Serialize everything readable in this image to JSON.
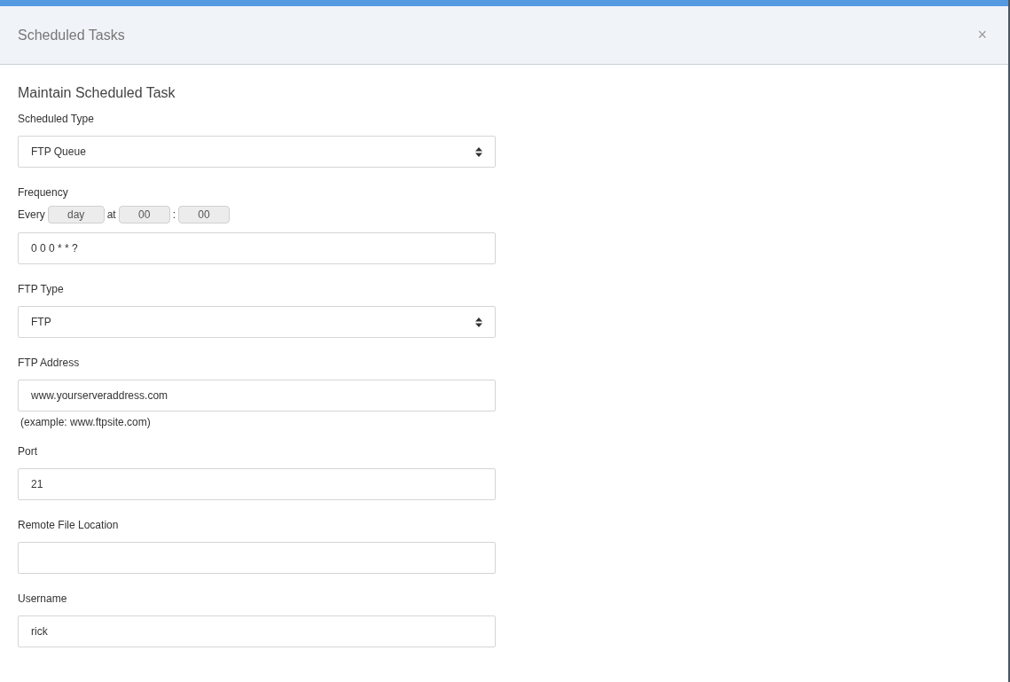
{
  "window": {
    "title": "Scheduled Tasks",
    "close": "×"
  },
  "form": {
    "title": "Maintain Scheduled Task",
    "fields": [
      {
        "kind": "select",
        "label": "Scheduled Type",
        "value": "FTP Queue"
      },
      {
        "kind": "schedule",
        "label": "Frequency",
        "every_label": "Every",
        "period": "day",
        "at_label": "at",
        "hour": "00",
        "separator": ":",
        "minute": "00",
        "value": "0 0 0 * * ?"
      },
      {
        "kind": "select",
        "label": "FTP Type",
        "value": "FTP"
      },
      {
        "kind": "text",
        "label": "FTP Address",
        "value": "www.yourserveraddress.com",
        "hint": "(example: www.ftpsite.com)"
      },
      {
        "kind": "text",
        "label": "Port",
        "value": "21"
      },
      {
        "kind": "text",
        "label": "Remote File Location"
      },
      {
        "kind": "text",
        "label": "Username",
        "value": "rick"
      }
    ]
  }
}
